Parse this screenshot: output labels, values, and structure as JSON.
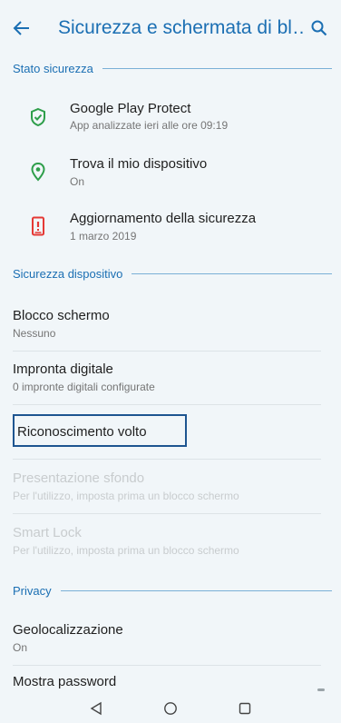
{
  "header": {
    "title": "Sicurezza e schermata di bl…",
    "back_icon": "arrow-left-icon",
    "search_icon": "search-icon"
  },
  "colors": {
    "accent": "#1b6fb3",
    "protect_green": "#2e9e4a",
    "update_red": "#e53935",
    "background": "#f1f6f9"
  },
  "sections": {
    "stato": "Stato sicurezza",
    "dispositivo": "Sicurezza dispositivo",
    "privacy": "Privacy"
  },
  "status_items": [
    {
      "title": "Google Play Protect",
      "subtitle": "App analizzate ieri alle ore 09:19",
      "icon": "shield-check-icon"
    },
    {
      "title": "Trova il mio dispositivo",
      "subtitle": "On",
      "icon": "location-pin-icon"
    },
    {
      "title": "Aggiornamento della sicurezza",
      "subtitle": "1 marzo 2019",
      "icon": "phone-alert-icon"
    }
  ],
  "device_items": [
    {
      "title": "Blocco schermo",
      "subtitle": "Nessuno"
    },
    {
      "title": "Impronta digitale",
      "subtitle": "0 impronte digitali configurate"
    },
    {
      "title": "Riconoscimento volto"
    },
    {
      "title": "Presentazione sfondo",
      "subtitle": "Per l'utilizzo, imposta prima un blocco schermo",
      "disabled": true
    },
    {
      "title": "Smart Lock",
      "subtitle": "Per l'utilizzo, imposta prima un blocco schermo",
      "disabled": true
    }
  ],
  "privacy_items": [
    {
      "title": "Geolocalizzazione",
      "subtitle": "On"
    },
    {
      "title": "Mostra password"
    }
  ],
  "navbar": {
    "back": "nav-back-icon",
    "home": "nav-home-icon",
    "recents": "nav-recents-icon"
  }
}
